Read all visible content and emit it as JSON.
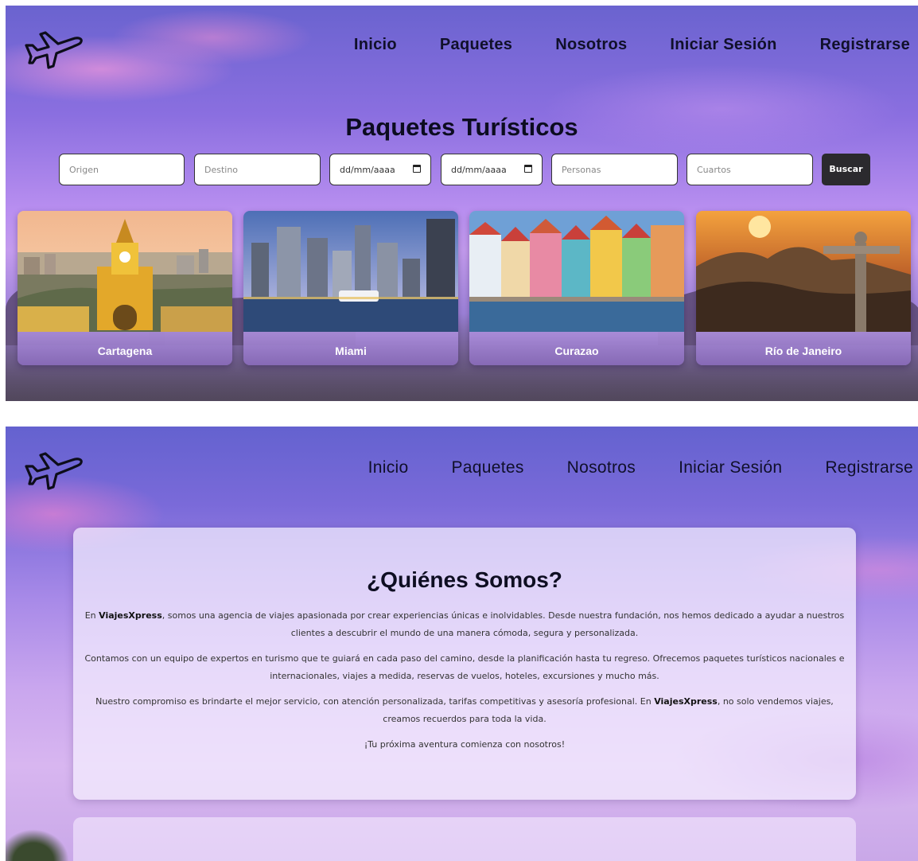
{
  "nav": {
    "items": [
      "Inicio",
      "Paquetes",
      "Nosotros",
      "Iniciar Sesión",
      "Registrarse"
    ]
  },
  "packages": {
    "title": "Paquetes Turísticos",
    "search": {
      "origin_placeholder": "Origen",
      "destination_placeholder": "Destino",
      "date_start": "dd/mm/aaaa",
      "date_end": "dd/mm/aaaa",
      "people_placeholder": "Personas",
      "rooms_placeholder": "Cuartos",
      "button": "Buscar"
    },
    "cards": [
      "Cartagena",
      "Miami",
      "Curazao",
      "Río de Janeiro"
    ]
  },
  "about": {
    "title": "¿Quiénes Somos?",
    "brand": "ViajesXpress",
    "p1_a": "En ",
    "p1_b": ", somos una agencia de viajes apasionada por crear experiencias únicas e inolvidables. Desde nuestra fundación, nos hemos dedicado a ayudar a nuestros clientes a descubrir el mundo de una manera cómoda, segura y personalizada.",
    "p2": "Contamos con un equipo de expertos en turismo que te guiará en cada paso del camino, desde la planificación hasta tu regreso. Ofrecemos paquetes turísticos nacionales e internacionales, viajes a medida, reservas de vuelos, hoteles, excursiones y mucho más.",
    "p3_a": "Nuestro compromiso es brindarte el mejor servicio, con atención personalizada, tarifas competitivas y asesoría profesional. En ",
    "p3_b": ", no solo vendemos viajes, creamos recuerdos para toda la vida.",
    "p4": "¡Tu próxima aventura comienza con nosotros!"
  },
  "icons": {
    "logo": "airplane-icon",
    "date": "calendar-icon"
  },
  "colors": {
    "button": "#2b2a2e",
    "text": "#10102a"
  }
}
